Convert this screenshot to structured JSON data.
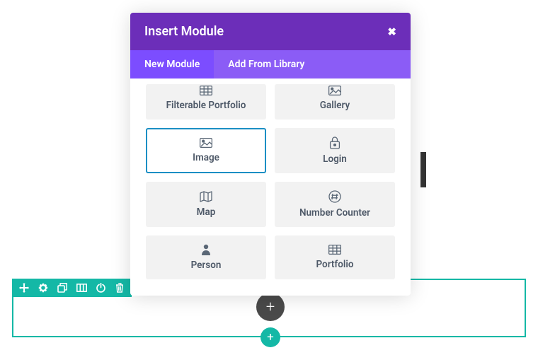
{
  "modal": {
    "title": "Insert Module",
    "tabs": [
      {
        "label": "New Module",
        "active": true
      },
      {
        "label": "Add From Library",
        "active": false
      }
    ],
    "modules": [
      {
        "label": "Filterable Portfolio",
        "icon": "grid-icon"
      },
      {
        "label": "Gallery",
        "icon": "image-icon"
      },
      {
        "label": "Image",
        "icon": "image-icon",
        "selected": true
      },
      {
        "label": "Login",
        "icon": "lock-icon"
      },
      {
        "label": "Map",
        "icon": "map-icon"
      },
      {
        "label": "Number Counter",
        "icon": "hash-icon"
      },
      {
        "label": "Person",
        "icon": "person-icon"
      },
      {
        "label": "Portfolio",
        "icon": "grid-icon"
      }
    ]
  },
  "section_toolbar": {
    "items": [
      {
        "name": "move-icon"
      },
      {
        "name": "gear-icon"
      },
      {
        "name": "duplicate-icon"
      },
      {
        "name": "columns-icon"
      },
      {
        "name": "power-icon"
      },
      {
        "name": "trash-icon"
      }
    ]
  },
  "plus": "+"
}
